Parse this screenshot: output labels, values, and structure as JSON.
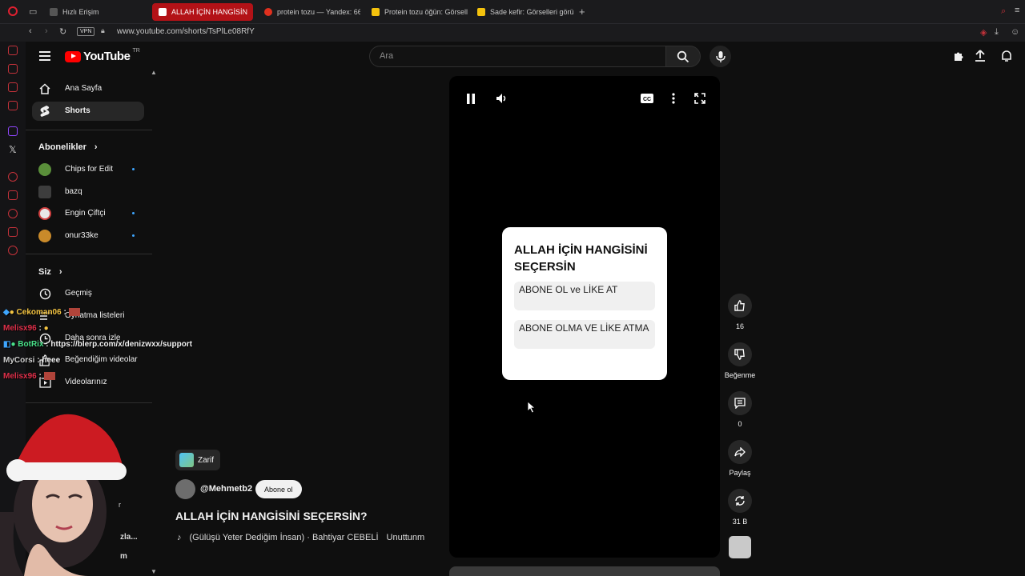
{
  "browser": {
    "tabs": [
      {
        "label": "Hızlı Erişim",
        "active": false,
        "color": "#888888"
      },
      {
        "label": "ALLAH İÇİN HANGİSİN",
        "active": true,
        "color": "#ffffff"
      },
      {
        "label": "protein tozu — Yandex: 66",
        "active": false,
        "color": "#e0301e"
      },
      {
        "label": "Protein tozu öğün: Görselle",
        "active": false,
        "color": "#f4c20d"
      },
      {
        "label": "Sade kefir: Görselleri görü",
        "active": false,
        "color": "#f4c20d"
      }
    ],
    "vpn_label": "VPN",
    "url": "www.youtube.com/shorts/TsPlLe08RfY"
  },
  "header": {
    "logo_text": "YouTube",
    "region": "TR",
    "search_placeholder": "Ara"
  },
  "sidebar": {
    "main": [
      {
        "label": "Ana Sayfa",
        "icon": "home-icon"
      },
      {
        "label": "Shorts",
        "icon": "shorts-icon"
      }
    ],
    "subs_header": "Abonelikler",
    "subscriptions": [
      {
        "label": "Chips for Edit",
        "color": "#5a8f3a",
        "new": true
      },
      {
        "label": "bazq",
        "color": "#3d3d3d",
        "new": false
      },
      {
        "label": "Engin Çiftçi",
        "color": "#e8e8e8",
        "new": true
      },
      {
        "label": "onur33ke",
        "color": "#c98a2a",
        "new": true
      }
    ],
    "you_header": "Siz",
    "you_items": [
      {
        "label": "Geçmiş",
        "icon": "history-icon"
      },
      {
        "label": "Oynatma listeleri",
        "icon": "playlist-icon"
      },
      {
        "label": "Daha sonra izle",
        "icon": "clock-icon"
      },
      {
        "label": "Beğendiğim videolar",
        "icon": "like-icon"
      },
      {
        "label": "Videolarınız",
        "icon": "video-icon"
      }
    ]
  },
  "short": {
    "card_title": "ALLAH İÇİN HANGİSİNİ SEÇERSİN",
    "option1": "ABONE OL ve LİKE AT",
    "option2": "ABONE OLMA VE LİKE ATMA",
    "tag_label": "Zarif",
    "channel": "@Mehmetb2",
    "subscribe_label": "Abone ol",
    "title": "ALLAH İÇİN HANGİSİNİ SEÇERSİN?",
    "music": "(Gülüşü Yeter Dediğim İnsan) · Bahtiyar CEBELİ",
    "music_extra": "Unuttunm"
  },
  "actions": {
    "likes": "16",
    "dislike_label": "Beğenme",
    "comments": "0",
    "share_label": "Paylaş",
    "remix_count": "31 B"
  },
  "overlay": {
    "chat": [
      {
        "user": "Cekoman06",
        "text": ":",
        "color": "#f5c542"
      },
      {
        "user": "Melisx96",
        "text": ":",
        "color": "#e0304a"
      },
      {
        "user": "BotRix",
        "text": ": https://blerp.com/x/denizwxx/support",
        "color": "#49e38a"
      },
      {
        "user": "MyCorsi",
        "text": ": heee",
        "color": "#cfcfcf"
      },
      {
        "user": "Melisx96",
        "text": ":",
        "color": "#e0304a"
      }
    ],
    "partial_1": "zla...",
    "partial_2": "m",
    "partial_3": "r"
  },
  "colors": {
    "brand": "#ff0000",
    "accent": "#3ea6ff",
    "active_tab": "#b31217"
  }
}
